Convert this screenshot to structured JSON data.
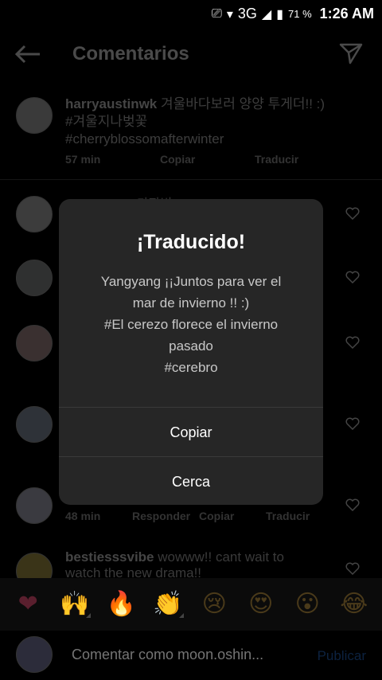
{
  "status_bar": {
    "network": "3G",
    "battery": "71 %",
    "time": "1:26 AM"
  },
  "header": {
    "title": "Comentarios"
  },
  "caption": {
    "username": "harryaustinwk",
    "text": "겨울바다보러 양양 투게더!! :)",
    "line2": "#겨울지나벚꽃",
    "line3": "#cherryblossomafterwinter",
    "time": "57 min",
    "copy_label": "Copiar",
    "translate_label": "Traducir"
  },
  "comments": [
    {
      "partial_text": "가자빈"
    },
    {
      "meta_time": "48 min",
      "reply_label": "Responder",
      "copy_label": "Copiar",
      "translate_label": "Traducir"
    },
    {
      "username": "bestiesssvibe",
      "text": "wowww!! cant wait to",
      "text2": "watch the new drama!!"
    }
  ],
  "emoji_bar": {
    "items": [
      "❤",
      "🙌",
      "🔥",
      "👏",
      "😢",
      "😍",
      "😮",
      "😂"
    ]
  },
  "input": {
    "placeholder": "Comentar como moon.oshin...",
    "publish_label": "Publicar"
  },
  "dialog": {
    "title": "¡Traducido!",
    "lines": [
      "Yangyang ¡¡Juntos para ver el",
      "mar de invierno !! :)",
      "#El cerezo florece el invierno",
      "pasado",
      "#cerebro"
    ],
    "copy_button": "Copiar",
    "close_button": "Cerca"
  },
  "colors": {
    "dialog_bg": "#262626",
    "background": "#000000"
  }
}
